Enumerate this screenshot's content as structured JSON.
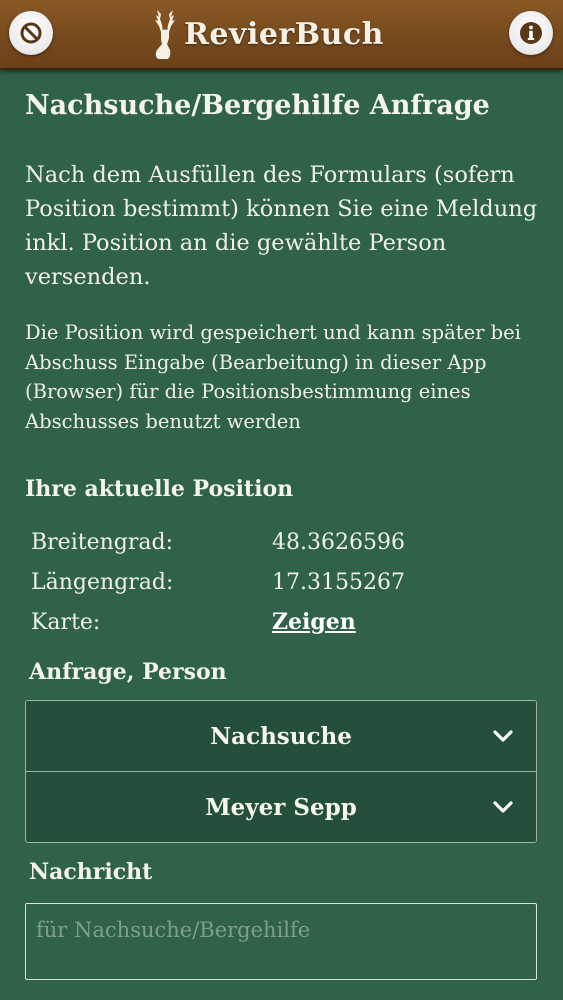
{
  "header": {
    "app_name": "RevierBuch",
    "left_icon": "ban-icon",
    "right_icon": "info-icon"
  },
  "page": {
    "title": "Nachsuche/Bergehilfe Anfrage",
    "intro": "Nach dem Ausfüllen des Formulars (sofern Position bestimmt) können Sie eine Meldung inkl. Position an die gewählte Person versenden.",
    "note": "Die Position wird gespeichert und kann später bei Abschuss Eingabe (Bearbeitung) in dieser App (Browser) für die Positionsbestimmung eines Abschusses benutzt werden"
  },
  "position": {
    "heading": "Ihre aktuelle Position",
    "lat_label": "Breitengrad:",
    "lat_value": "48.3626596",
    "lon_label": "Längengrad:",
    "lon_value": "17.3155267",
    "map_label": "Karte:",
    "map_link": "Zeigen"
  },
  "request": {
    "heading": "Anfrage, Person",
    "type_selected": "Nachsuche",
    "person_selected": "Meyer Sepp"
  },
  "message": {
    "heading": "Nachricht",
    "placeholder": "für Nachsuche/Bergehilfe"
  },
  "colors": {
    "background": "#2f6248",
    "header": "#7a4d1f",
    "select_bg": "#244f3a"
  }
}
